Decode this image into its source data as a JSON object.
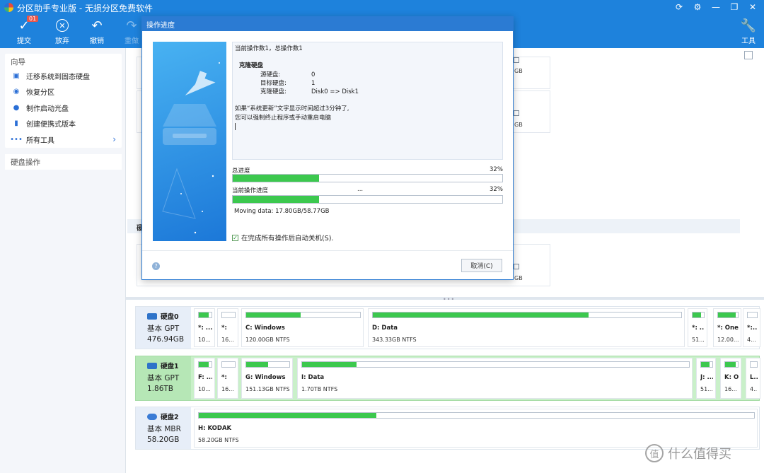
{
  "window": {
    "title": "分区助手专业版 - 无损分区免费软件"
  },
  "toolbar": {
    "submit": {
      "label": "提交",
      "badge": "01"
    },
    "discard": {
      "label": "放弃"
    },
    "undo": {
      "label": "撤销"
    },
    "redo": {
      "label": "重做"
    },
    "tools": {
      "label": "工具"
    }
  },
  "sidebar": {
    "wizard_title": "向导",
    "items": [
      {
        "label": "迁移系统到固态硬盘"
      },
      {
        "label": "恢复分区"
      },
      {
        "label": "制作启动光盘"
      },
      {
        "label": "创建便携式版本"
      },
      {
        "label": "所有工具"
      }
    ],
    "disk_ops_title": "硬盘操作"
  },
  "background": {
    "strip_label": "硬",
    "gb": "GB"
  },
  "dialog": {
    "title": "操作进度",
    "log": {
      "line1": "当前操作数1，总操作数1",
      "op_title": "克隆硬盘",
      "rows": [
        {
          "k": "源硬盘:",
          "v": "0"
        },
        {
          "k": "目标硬盘:",
          "v": "1"
        },
        {
          "k": "克隆硬盘:",
          "v": "Disk0 => Disk1"
        }
      ],
      "note1": "如果“系统更新”文字显示时间超过3分钟了,",
      "note2": "您可以强制终止程序或手动重启电脑"
    },
    "total_progress": {
      "label": "总进度",
      "pct_text": "32%",
      "value": 0.32
    },
    "current_progress": {
      "label": "当前操作进度",
      "status": "...",
      "pct_text": "32%",
      "value": 0.32
    },
    "moving": "Moving data: 17.80GB/58.77GB",
    "auto_shutdown": {
      "label": "在完成所有操作后自动关机(S).",
      "checked": true
    },
    "cancel_label": "取消(C)"
  },
  "disks": [
    {
      "name": "硬盘0",
      "type": "基本 GPT",
      "size": "476.94GB",
      "partitions": [
        {
          "label": "*: ...",
          "detail": "10...",
          "used": 0.75
        },
        {
          "label": "*:",
          "detail": "16...",
          "used": 0.0
        },
        {
          "label": "C: Windows",
          "detail": "120.00GB NTFS",
          "used": 0.48
        },
        {
          "label": "D: Data",
          "detail": "343.33GB NTFS",
          "used": 0.7
        },
        {
          "label": "*: ...",
          "detail": "51...",
          "used": 0.75
        },
        {
          "label": "*: One...",
          "detail": "12.00...",
          "used": 0.9
        },
        {
          "label": "*:...",
          "detail": "4...",
          "used": 0.0
        }
      ]
    },
    {
      "name": "硬盘1",
      "type": "基本 GPT",
      "size": "1.86TB",
      "partitions": [
        {
          "label": "F: ...",
          "detail": "10...",
          "used": 0.75
        },
        {
          "label": "*:",
          "detail": "16...",
          "used": 0.0
        },
        {
          "label": "G: Windows",
          "detail": "151.13GB NTFS",
          "used": 0.5
        },
        {
          "label": "I: Data",
          "detail": "1.70TB NTFS",
          "used": 0.14
        },
        {
          "label": "J: ...",
          "detail": "51...",
          "used": 0.75
        },
        {
          "label": "K: O...",
          "detail": "16...",
          "used": 0.85
        },
        {
          "label": "L...",
          "detail": "4...",
          "used": 0.0
        }
      ]
    },
    {
      "name": "硬盘2",
      "type": "基本 MBR",
      "size": "58.20GB",
      "partitions": [
        {
          "label": "H: KODAK",
          "detail": "58.20GB NTFS",
          "used": 0.32
        }
      ]
    }
  ],
  "watermark": "什么值得买"
}
